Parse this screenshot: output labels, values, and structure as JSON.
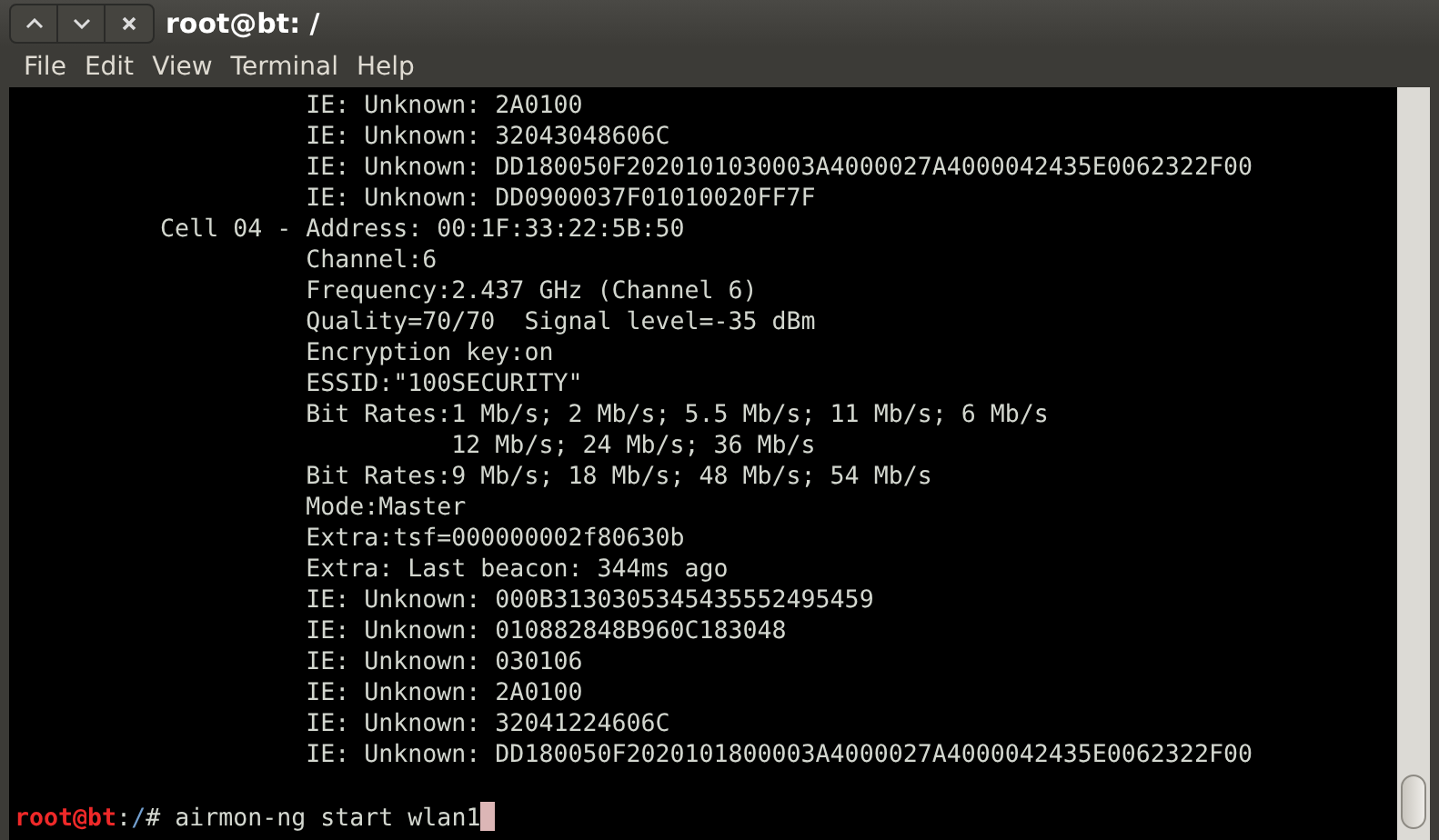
{
  "window": {
    "title": "root@bt: /"
  },
  "menu": [
    "File",
    "Edit",
    "View",
    "Terminal",
    "Help"
  ],
  "terminal": {
    "lines": [
      "                    IE: Unknown: 2A0100",
      "                    IE: Unknown: 32043048606C",
      "                    IE: Unknown: DD180050F2020101030003A4000027A4000042435E0062322F00",
      "                    IE: Unknown: DD0900037F01010020FF7F",
      "          Cell 04 - Address: 00:1F:33:22:5B:50",
      "                    Channel:6",
      "                    Frequency:2.437 GHz (Channel 6)",
      "                    Quality=70/70  Signal level=-35 dBm",
      "                    Encryption key:on",
      "                    ESSID:\"100SECURITY\"",
      "                    Bit Rates:1 Mb/s; 2 Mb/s; 5.5 Mb/s; 11 Mb/s; 6 Mb/s",
      "                              12 Mb/s; 24 Mb/s; 36 Mb/s",
      "                    Bit Rates:9 Mb/s; 18 Mb/s; 48 Mb/s; 54 Mb/s",
      "                    Mode:Master",
      "                    Extra:tsf=000000002f80630b",
      "                    Extra: Last beacon: 344ms ago",
      "                    IE: Unknown: 000B3130305345435552495459",
      "                    IE: Unknown: 010882848B960C183048",
      "                    IE: Unknown: 030106",
      "                    IE: Unknown: 2A0100",
      "                    IE: Unknown: 32041224606C",
      "                    IE: Unknown: DD180050F2020101800003A4000027A4000042435E0062322F00"
    ],
    "prompt": {
      "user_host": "root@bt",
      "separator": ":",
      "path": "/",
      "command": "# airmon-ng start wlan1"
    },
    "cursor_visible": true
  }
}
